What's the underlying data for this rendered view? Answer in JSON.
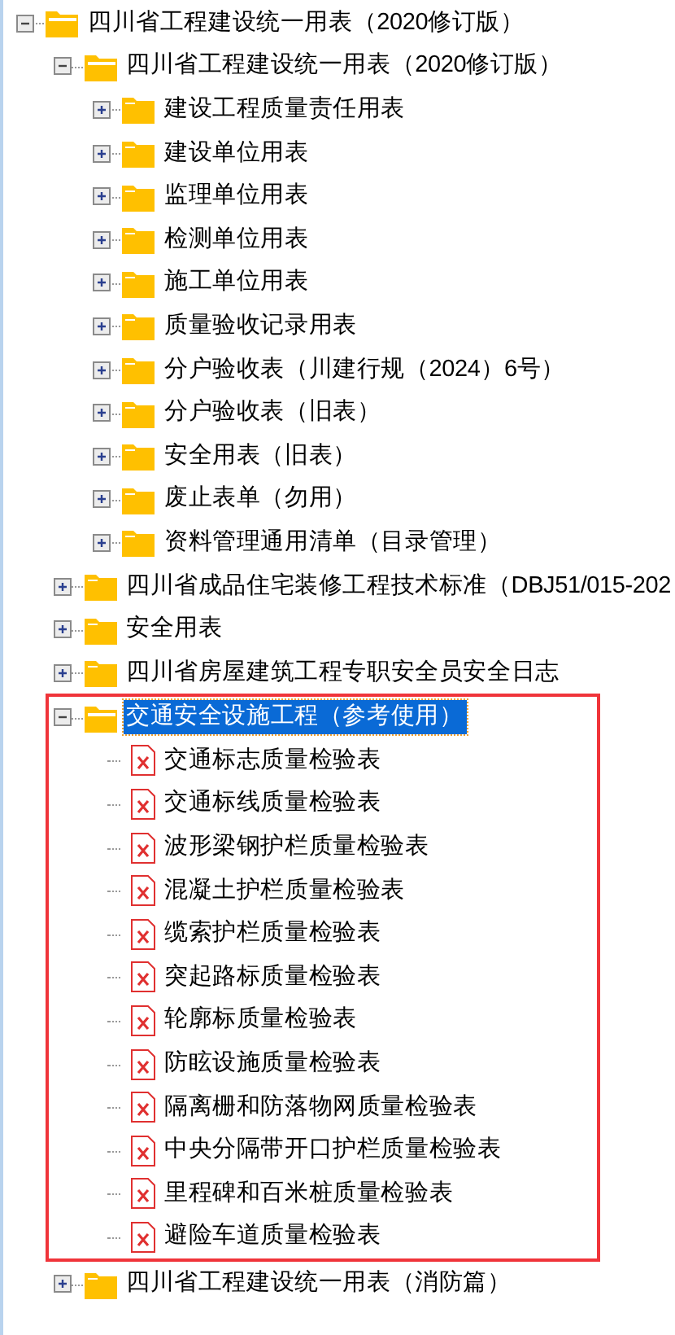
{
  "tree": [
    {
      "label": "四川省工程建设统一用表（2020修订版）",
      "kind": "folder",
      "expanded": true,
      "selected": false,
      "children": [
        {
          "label": "四川省工程建设统一用表（2020修订版）",
          "kind": "folder",
          "expanded": true,
          "selected": false,
          "children": [
            {
              "label": "建设工程质量责任用表",
              "kind": "folder",
              "expanded": false,
              "selected": false
            },
            {
              "label": "建设单位用表",
              "kind": "folder",
              "expanded": false,
              "selected": false
            },
            {
              "label": "监理单位用表",
              "kind": "folder",
              "expanded": false,
              "selected": false
            },
            {
              "label": "检测单位用表",
              "kind": "folder",
              "expanded": false,
              "selected": false
            },
            {
              "label": "施工单位用表",
              "kind": "folder",
              "expanded": false,
              "selected": false
            },
            {
              "label": "质量验收记录用表",
              "kind": "folder",
              "expanded": false,
              "selected": false
            },
            {
              "label": "分户验收表（川建行规（2024）6号）",
              "kind": "folder",
              "expanded": false,
              "selected": false
            },
            {
              "label": "分户验收表（旧表）",
              "kind": "folder",
              "expanded": false,
              "selected": false
            },
            {
              "label": "安全用表（旧表）",
              "kind": "folder",
              "expanded": false,
              "selected": false
            },
            {
              "label": "废止表单（勿用）",
              "kind": "folder",
              "expanded": false,
              "selected": false
            },
            {
              "label": "资料管理通用清单（目录管理）",
              "kind": "folder",
              "expanded": false,
              "selected": false
            }
          ]
        },
        {
          "label": "四川省成品住宅装修工程技术标准（DBJ51/015-202",
          "kind": "folder",
          "expanded": false,
          "selected": false
        },
        {
          "label": "安全用表",
          "kind": "folder",
          "expanded": false,
          "selected": false
        },
        {
          "label": "四川省房屋建筑工程专职安全员安全日志",
          "kind": "folder",
          "expanded": false,
          "selected": false
        },
        {
          "label": "交通安全设施工程（参考使用）",
          "kind": "folder",
          "expanded": true,
          "selected": true,
          "highlight": true,
          "children": [
            {
              "label": "交通标志质量检验表",
              "kind": "file",
              "selected": false
            },
            {
              "label": "交通标线质量检验表",
              "kind": "file",
              "selected": false
            },
            {
              "label": "波形梁钢护栏质量检验表",
              "kind": "file",
              "selected": false
            },
            {
              "label": "混凝土护栏质量检验表",
              "kind": "file",
              "selected": false
            },
            {
              "label": "缆索护栏质量检验表",
              "kind": "file",
              "selected": false
            },
            {
              "label": "突起路标质量检验表",
              "kind": "file",
              "selected": false
            },
            {
              "label": "轮廓标质量检验表",
              "kind": "file",
              "selected": false
            },
            {
              "label": "防眩设施质量检验表",
              "kind": "file",
              "selected": false
            },
            {
              "label": "隔离栅和防落物网质量检验表",
              "kind": "file",
              "selected": false
            },
            {
              "label": "中央分隔带开口护栏质量检验表",
              "kind": "file",
              "selected": false
            },
            {
              "label": "里程碑和百米桩质量检验表",
              "kind": "file",
              "selected": false
            },
            {
              "label": "避险车道质量检验表",
              "kind": "file",
              "selected": false
            }
          ]
        },
        {
          "label": "四川省工程建设统一用表（消防篇）",
          "kind": "folder",
          "expanded": false,
          "selected": false
        }
      ]
    }
  ]
}
